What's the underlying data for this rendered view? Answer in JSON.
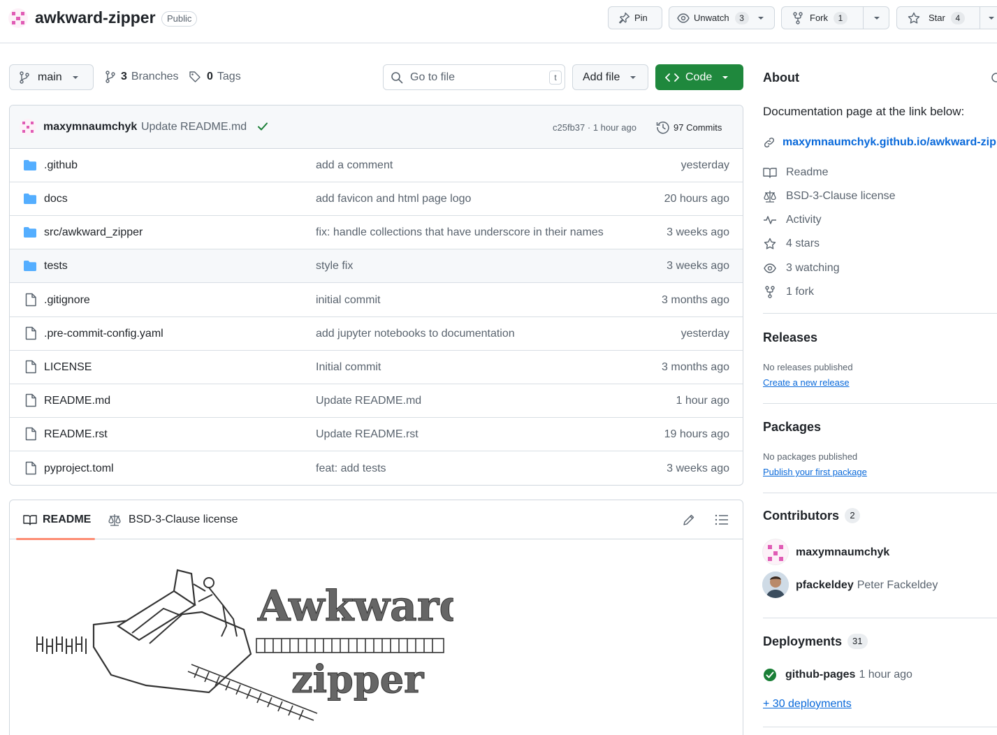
{
  "repo": {
    "name": "awkward-zipper",
    "visibility": "Public",
    "actions": {
      "pin_label": "Pin",
      "unwatch_label": "Unwatch",
      "unwatch_count": "3",
      "fork_label": "Fork",
      "fork_count": "1",
      "star_label": "Star",
      "star_count": "4"
    }
  },
  "toolbar": {
    "branch": "main",
    "branches_count": "3",
    "branches_label": "Branches",
    "tags_count": "0",
    "tags_label": "Tags",
    "goto_placeholder": "Go to file",
    "goto_shortcut": "t",
    "add_file_label": "Add file",
    "code_label": "Code"
  },
  "latest_commit": {
    "author": "maxymnaumchyk",
    "message": "Update README.md",
    "hash_time": "c25fb37 · 1 hour ago",
    "commits_label": "97 Commits"
  },
  "files": [
    {
      "type": "dir",
      "name": ".github",
      "message": "add a comment",
      "date": "yesterday"
    },
    {
      "type": "dir",
      "name": "docs",
      "message": "add favicon and html page logo",
      "date": "20 hours ago"
    },
    {
      "type": "dir",
      "name": "src/awkward_zipper",
      "message": "fix: handle collections that have underscore in their names",
      "date": "3 weeks ago"
    },
    {
      "type": "dir",
      "name": "tests",
      "message": "style fix",
      "date": "3 weeks ago"
    },
    {
      "type": "file",
      "name": ".gitignore",
      "message": "initial commit",
      "date": "3 months ago"
    },
    {
      "type": "file",
      "name": ".pre-commit-config.yaml",
      "message": "add jupyter notebooks to documentation",
      "date": "yesterday"
    },
    {
      "type": "file",
      "name": "LICENSE",
      "message": "Initial commit",
      "date": "3 months ago"
    },
    {
      "type": "file",
      "name": "README.md",
      "message": "Update README.md",
      "date": "1 hour ago"
    },
    {
      "type": "file",
      "name": "README.rst",
      "message": "Update README.rst",
      "date": "19 hours ago"
    },
    {
      "type": "file",
      "name": "pyproject.toml",
      "message": "feat: add tests",
      "date": "3 weeks ago"
    }
  ],
  "readme": {
    "tab_readme": "README",
    "tab_license": "BSD-3-Clause license",
    "logo_title": "Awkward",
    "logo_subtitle": "zipper"
  },
  "about": {
    "heading": "About",
    "description": "Documentation page at the link below:",
    "link": "maxymnaumchyk.github.io/awkward-zip...",
    "items": {
      "readme": "Readme",
      "license": "BSD-3-Clause license",
      "activity": "Activity",
      "stars": "4 stars",
      "watching": "3 watching",
      "forks": "1 fork"
    }
  },
  "releases": {
    "heading": "Releases",
    "empty": "No releases published",
    "link": "Create a new release"
  },
  "packages": {
    "heading": "Packages",
    "empty": "No packages published",
    "link": "Publish your first package"
  },
  "contributors": {
    "heading": "Contributors",
    "count": "2",
    "people": [
      {
        "login": "maxymnaumchyk",
        "name": ""
      },
      {
        "login": "pfackeldey",
        "name": "Peter Fackeldey"
      }
    ]
  },
  "deployments": {
    "heading": "Deployments",
    "count": "31",
    "env": "github-pages",
    "time": "1 hour ago",
    "more_link": "+ 30 deployments"
  },
  "colors": {
    "accent_blue": "#0969da",
    "code_green": "#1f883d",
    "folder_blue": "#54aeff",
    "tab_underline": "#fd8c73",
    "success_green": "#1a7f37"
  }
}
